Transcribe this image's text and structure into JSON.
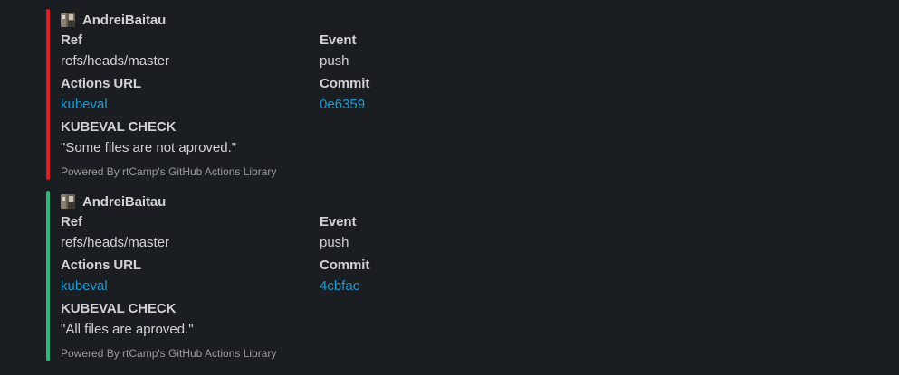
{
  "colors": {
    "background": "#1a1d21",
    "text": "#d1d2d3",
    "link": "#1d9bd1",
    "footer_text": "#9a9b9d",
    "failure_bar": "#e01e1e",
    "success_bar": "#2eb67d"
  },
  "attachments": [
    {
      "status_color": "#e01e1e",
      "author": {
        "avatar_icon": "avatar-icon",
        "name": "AndreiBaitau"
      },
      "ref": {
        "label": "Ref",
        "value": "refs/heads/master"
      },
      "event": {
        "label": "Event",
        "value": "push"
      },
      "actions_url": {
        "label": "Actions URL",
        "value": "kubeval"
      },
      "commit": {
        "label": "Commit",
        "value": "0e6359"
      },
      "check": {
        "label": "KUBEVAL CHECK",
        "value": "\"Some files are not aproved.\""
      },
      "footer": "Powered By rtCamp's GitHub Actions Library"
    },
    {
      "status_color": "#2eb67d",
      "author": {
        "avatar_icon": "avatar-icon",
        "name": "AndreiBaitau"
      },
      "ref": {
        "label": "Ref",
        "value": "refs/heads/master"
      },
      "event": {
        "label": "Event",
        "value": "push"
      },
      "actions_url": {
        "label": "Actions URL",
        "value": "kubeval"
      },
      "commit": {
        "label": "Commit",
        "value": "4cbfac"
      },
      "check": {
        "label": "KUBEVAL CHECK",
        "value": "\"All files are aproved.\""
      },
      "footer": "Powered By rtCamp's GitHub Actions Library"
    }
  ]
}
